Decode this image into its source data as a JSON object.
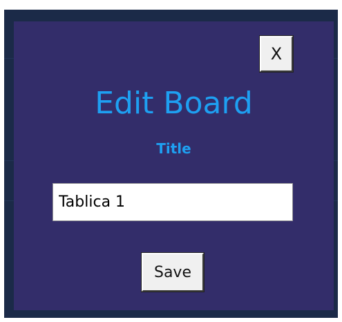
{
  "modal": {
    "close_label": "X",
    "heading": "Edit Board",
    "field_label": "Title",
    "title_value": "Tablica 1",
    "save_label": "Save"
  },
  "colors": {
    "backdrop": "#1b2a48",
    "modal_background": "#332d6a",
    "accent": "#1ea0f2",
    "button_face": "#f0f0f0"
  }
}
